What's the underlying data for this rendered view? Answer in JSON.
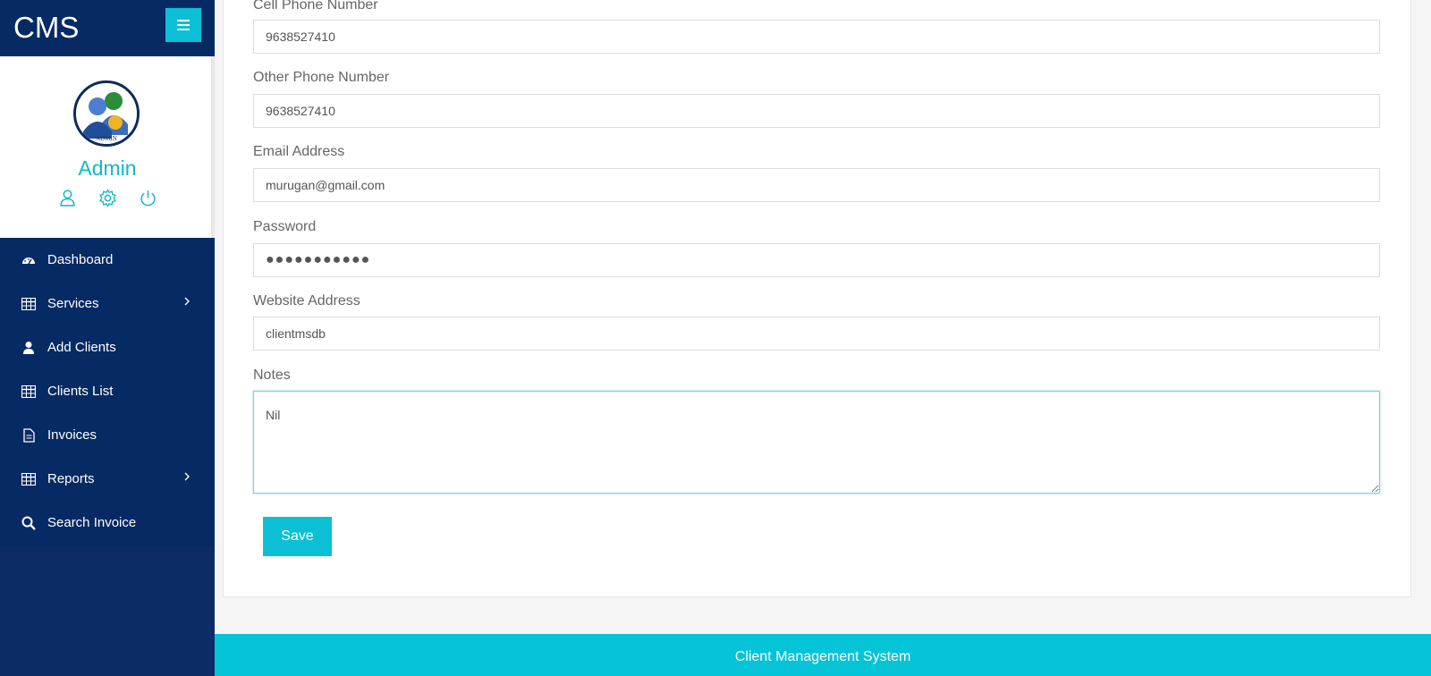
{
  "app": {
    "brand": "CMS"
  },
  "profile": {
    "name": "Admin",
    "avatar_text": "ADMIN"
  },
  "nav": {
    "items": [
      {
        "label": "Dashboard",
        "icon": "dashboard-icon",
        "has_submenu": false
      },
      {
        "label": "Services",
        "icon": "table-icon",
        "has_submenu": true
      },
      {
        "label": "Add Clients",
        "icon": "user-icon",
        "has_submenu": false
      },
      {
        "label": "Clients List",
        "icon": "table-icon",
        "has_submenu": false
      },
      {
        "label": "Invoices",
        "icon": "file-icon",
        "has_submenu": false
      },
      {
        "label": "Reports",
        "icon": "table-icon",
        "has_submenu": true
      },
      {
        "label": "Search Invoice",
        "icon": "search-icon",
        "has_submenu": false
      }
    ]
  },
  "form": {
    "cell_phone": {
      "label": "Cell Phone Number",
      "value": "9638527410"
    },
    "other_phone": {
      "label": "Other Phone Number",
      "value": "9638527410"
    },
    "email": {
      "label": "Email Address",
      "value": "murugan@gmail.com"
    },
    "password": {
      "label": "Password",
      "value": "●●●●●●●●●●●"
    },
    "website": {
      "label": "Website Address",
      "value": "clientmsdb"
    },
    "notes": {
      "label": "Notes",
      "value": "Nil"
    },
    "save_label": "Save"
  },
  "footer": {
    "text": "Client Management System"
  },
  "colors": {
    "sidebar": "#062a63",
    "accent": "#0bc0d4",
    "footer": "#05c4d8"
  }
}
